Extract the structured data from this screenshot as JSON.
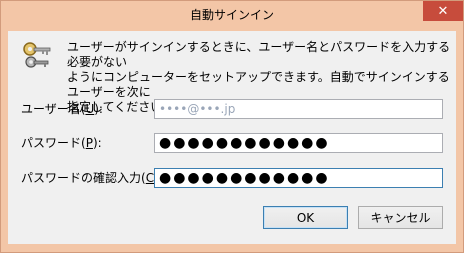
{
  "window": {
    "title": "自動サインイン",
    "close_glyph": "✕"
  },
  "description": {
    "line1": "ユーザーがサインインするときに、ユーザー名とパスワードを入力する必要がない",
    "line2": "ようにコンピューターをセットアップできます。自動でサインインするユーザーを次に",
    "line3": "指定してください:"
  },
  "form": {
    "username_label_prefix": "ユーザー名(",
    "username_label_key": "U",
    "username_label_suffix": "):",
    "username_value": "••••@•••.jp",
    "password_label_prefix": "パスワード(",
    "password_label_key": "P",
    "password_label_suffix": "):",
    "password_value": "●●●●●●●●●●●●",
    "confirm_label_prefix": "パスワードの確認入力(",
    "confirm_label_key": "C",
    "confirm_label_suffix": "):",
    "confirm_value": "●●●●●●●●●●●●"
  },
  "buttons": {
    "ok": "OK",
    "cancel": "キャンセル"
  },
  "icons": {
    "header": "keys-icon"
  }
}
